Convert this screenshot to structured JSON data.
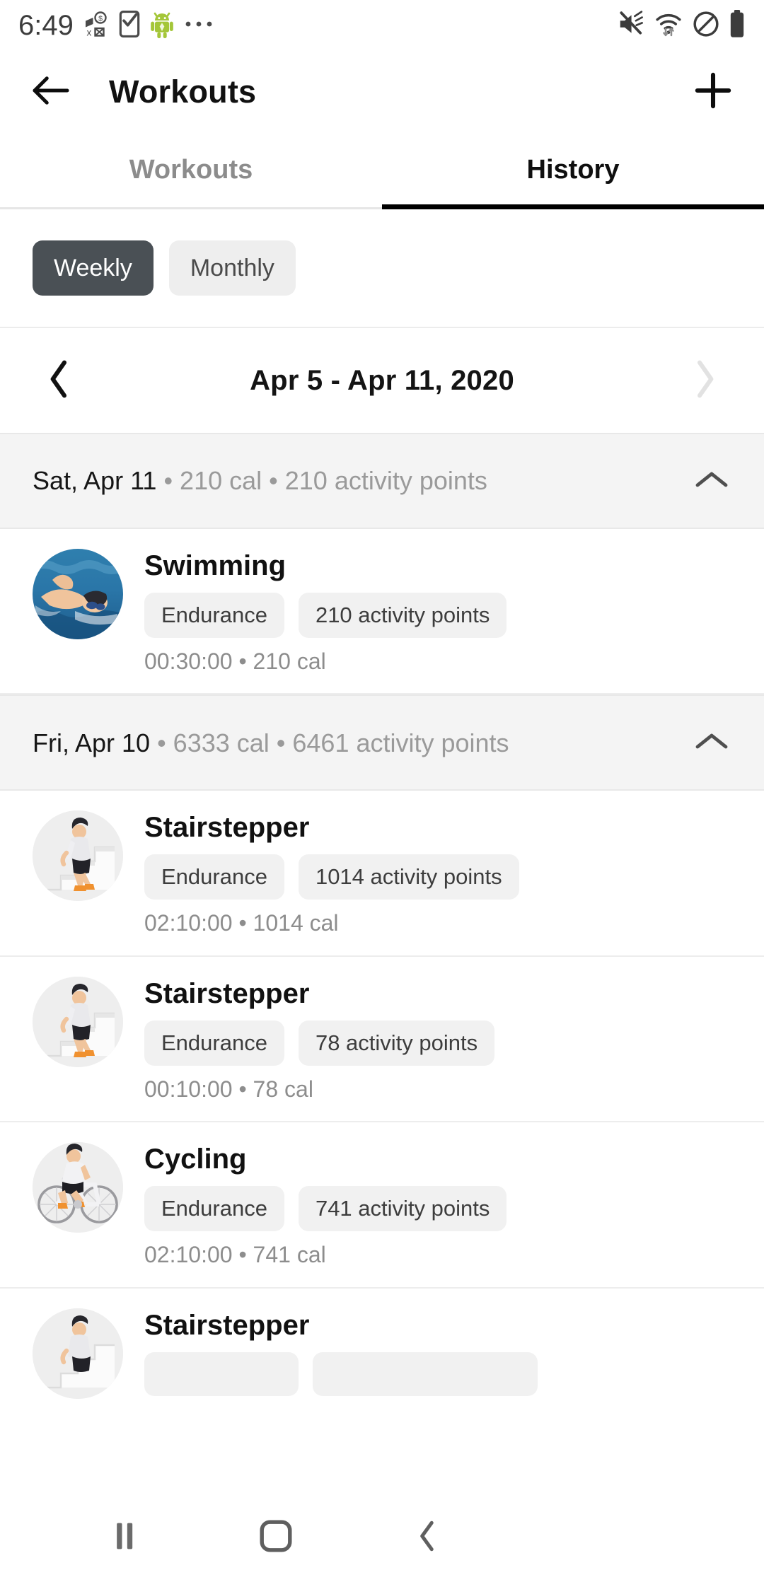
{
  "status_bar": {
    "time": "6:49",
    "left_icons": [
      "money-off-icon",
      "phone-check-icon",
      "android-robot-icon",
      "more-dots-icon"
    ],
    "right_icons": [
      "volume-mute-icon",
      "wifi-icon",
      "do-not-disturb-icon",
      "battery-full-icon"
    ]
  },
  "app_bar": {
    "back_icon": "arrow-left-icon",
    "title": "Workouts",
    "add_icon": "plus-icon"
  },
  "tabs": [
    {
      "label": "Workouts",
      "active": false
    },
    {
      "label": "History",
      "active": true
    }
  ],
  "filter": {
    "options": [
      {
        "label": "Weekly",
        "selected": true
      },
      {
        "label": "Monthly",
        "selected": false
      }
    ]
  },
  "date_nav": {
    "prev_icon": "chevron-left-icon",
    "next_icon": "chevron-right-icon",
    "range_label": "Apr 5 - Apr 11, 2020",
    "prev_enabled": true,
    "next_enabled": false
  },
  "groups": [
    {
      "date": "Sat, Apr 11",
      "meta": " • 210 cal • 210 activity points",
      "collapse_icon": "chevron-up-icon",
      "items": [
        {
          "avatar": "swimming-photo",
          "title": "Swimming",
          "chips": [
            "Endurance",
            "210 activity points"
          ],
          "sub": "00:30:00 • 210 cal"
        }
      ]
    },
    {
      "date": "Fri, Apr 10",
      "meta": " • 6333 cal • 6461 activity points",
      "collapse_icon": "chevron-up-icon",
      "items": [
        {
          "avatar": "stairstepper-photo",
          "title": "Stairstepper",
          "chips": [
            "Endurance",
            "1014 activity points"
          ],
          "sub": "02:10:00 • 1014 cal"
        },
        {
          "avatar": "stairstepper-photo",
          "title": "Stairstepper",
          "chips": [
            "Endurance",
            "78 activity points"
          ],
          "sub": "00:10:00 • 78 cal"
        },
        {
          "avatar": "cycling-photo",
          "title": "Cycling",
          "chips": [
            "Endurance",
            "741 activity points"
          ],
          "sub": "02:10:00 • 741 cal"
        },
        {
          "avatar": "stairstepper-photo",
          "title": "Stairstepper",
          "chips": [
            "",
            ""
          ],
          "sub": ""
        }
      ]
    }
  ],
  "nav_bar": {
    "recent_icon": "recents-icon",
    "home_icon": "home-icon",
    "back_icon": "nav-back-icon"
  },
  "colors": {
    "accent_dark": "#4a5055",
    "chip_bg": "#f1f1f1",
    "group_bg": "#f4f4f4",
    "muted_text": "#8d8d8d"
  }
}
